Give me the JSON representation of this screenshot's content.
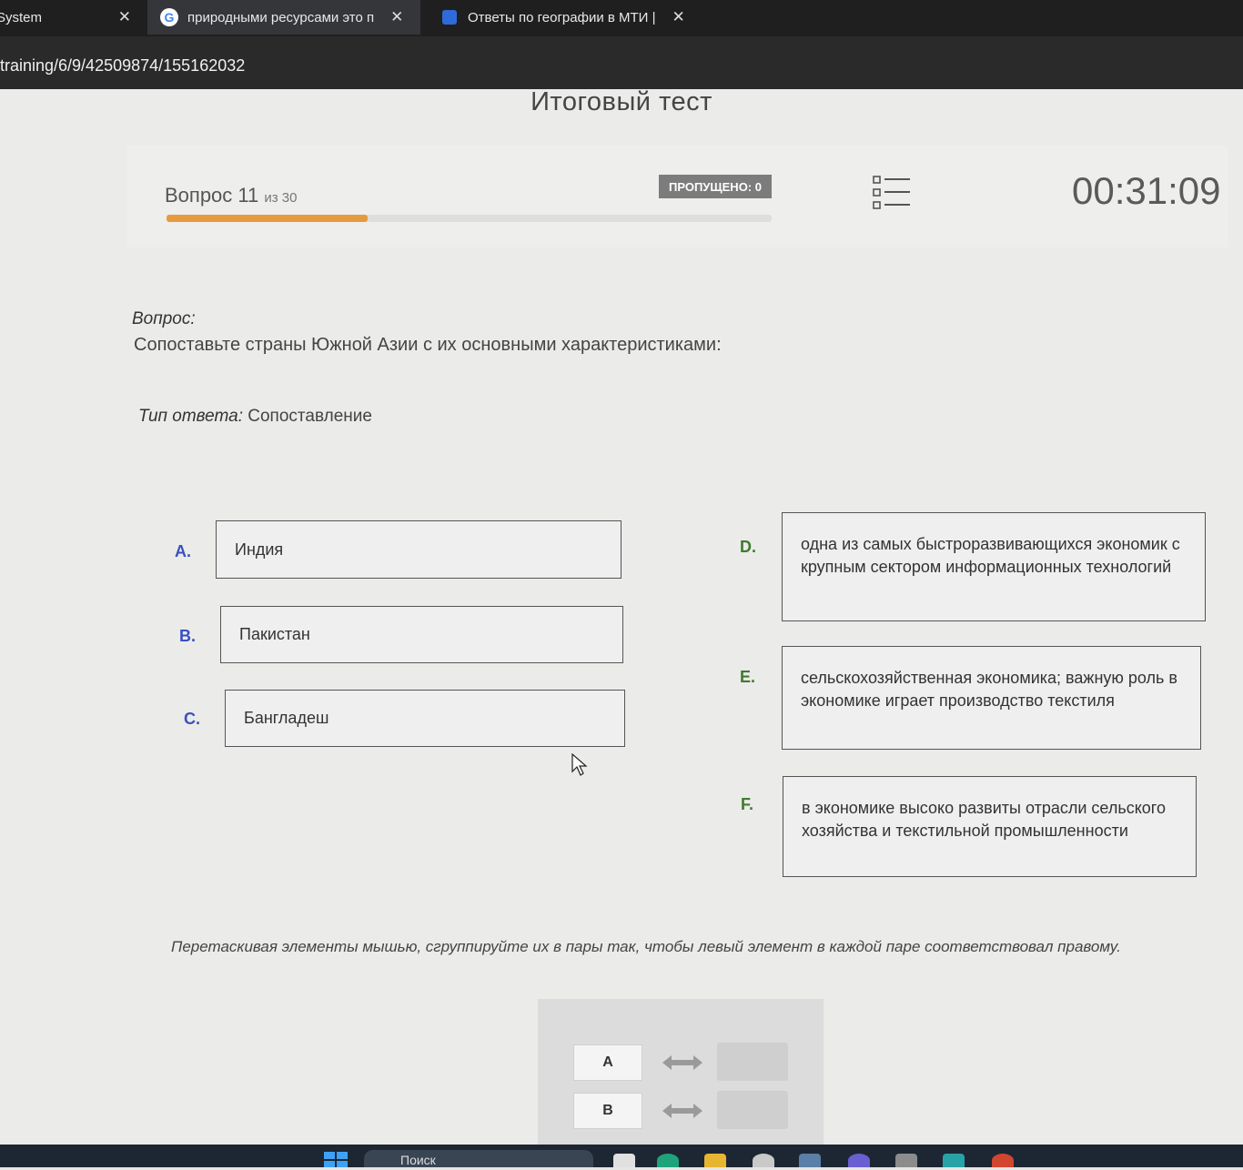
{
  "browser": {
    "tabs": [
      {
        "title": "System"
      },
      {
        "title": "природными ресурсами это п"
      },
      {
        "title": "Ответы по географии в МТИ |"
      }
    ],
    "url": "training/6/9/42509874/155162032"
  },
  "test": {
    "title": "Итоговый тест",
    "question_label": "Вопрос 11",
    "question_of": "из 30",
    "progress": 0.333,
    "skipped": "ПРОПУЩЕНО: 0",
    "timer": "00:31:09"
  },
  "question": {
    "label": "Вопрос:",
    "text": "Сопоставьте страны Южной Азии с их основными характеристиками:",
    "answer_type_label": "Тип ответа:",
    "answer_type": "Сопоставление"
  },
  "left_items": [
    {
      "letter": "A.",
      "text": "Индия"
    },
    {
      "letter": "B.",
      "text": "Пакистан"
    },
    {
      "letter": "C.",
      "text": "Бангладеш"
    }
  ],
  "right_items": [
    {
      "letter": "D.",
      "text": "одна из самых быстроразвивающихся экономик с крупным сектором информационных технологий"
    },
    {
      "letter": "E.",
      "text": "сельскохозяйственная экономика; важную роль в экономике играет производство текстиля"
    },
    {
      "letter": "F.",
      "text": "в экономике высоко развиты отрасли сельского хозяйства и текстильной промышленности"
    }
  ],
  "instruction": "Перетаскивая элементы мышью, сгруппируйте их в пары так, чтобы левый элемент в каждой паре соответствовал правому.",
  "match_slots": [
    {
      "label": "A"
    },
    {
      "label": "B"
    }
  ],
  "taskbar": {
    "search_placeholder": "Поиск"
  },
  "colors": {
    "progress": "#e79a3d",
    "left_letter": "#3a4fc0",
    "right_letter": "#3f7b2e",
    "badge": "#7c7c7c"
  }
}
